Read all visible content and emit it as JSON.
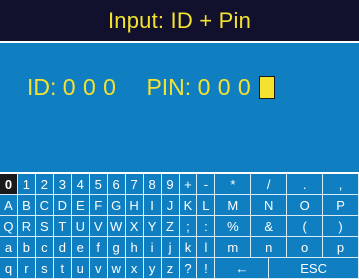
{
  "screen": {
    "title": "Input: ID + Pin"
  },
  "entry": {
    "id_label": "ID:",
    "id_value": "0 0 0",
    "pin_label": "PIN:",
    "pin_value": "0 0 0"
  },
  "keyboard": {
    "selected_key": "0",
    "rows": [
      [
        "0",
        "1",
        "2",
        "3",
        "4",
        "5",
        "6",
        "7",
        "8",
        "9",
        "+",
        "-",
        "*",
        "/",
        ".",
        ","
      ],
      [
        "A",
        "B",
        "C",
        "D",
        "E",
        "F",
        "G",
        "H",
        "I",
        "J",
        "K",
        "L",
        "M",
        "N",
        "O",
        "P"
      ],
      [
        "Q",
        "R",
        "S",
        "T",
        "U",
        "V",
        "W",
        "X",
        "Y",
        "Z",
        ";",
        ":",
        "%",
        "&",
        "(",
        ")"
      ],
      [
        "a",
        "b",
        "c",
        "d",
        "e",
        "f",
        "g",
        "h",
        "i",
        "j",
        "k",
        "l",
        "m",
        "n",
        "o",
        "p"
      ],
      [
        "q",
        "r",
        "s",
        "t",
        "u",
        "v",
        "w",
        "x",
        "y",
        "z",
        "?",
        "!",
        "←",
        "ESC"
      ]
    ]
  },
  "colors": {
    "title_bg": "#11112e",
    "screen_bg": "#0f7fc2",
    "accent_yellow": "#f5e22e",
    "selected_key_bg": "#1a1a1a"
  }
}
